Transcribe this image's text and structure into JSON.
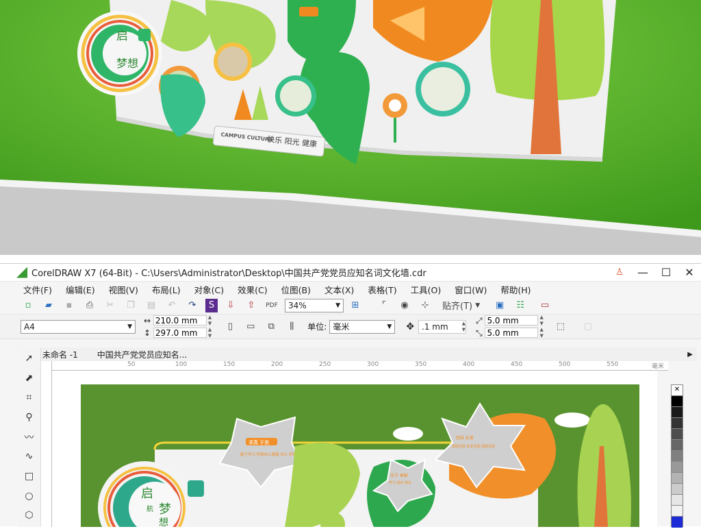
{
  "photo": {
    "campus_text": "CAMPUS CULTURE",
    "slogan": "快乐 阳光 健康",
    "badge_top": "启",
    "badge_bottom": "梦想",
    "colors": {
      "wall": "#58b62c",
      "floor": "#c9c9c9",
      "board": "#f0f0f0",
      "leaf_green": "#2fb050",
      "leaf_light": "#a8d85a",
      "orange": "#f08a20",
      "tree_green": "#a6d64a",
      "trunk": "#e0743a"
    }
  },
  "window": {
    "title": "CorelDRAW X7 (64-Bit) - C:\\Users\\Administrator\\Desktop\\中国共产党党员应知名词文化墙.cdr",
    "menu": [
      "文件(F)",
      "编辑(E)",
      "视图(V)",
      "布局(L)",
      "对象(C)",
      "效果(C)",
      "位图(B)",
      "文本(X)",
      "表格(T)",
      "工具(O)",
      "窗口(W)",
      "帮助(H)"
    ],
    "toolbar": {
      "zoom": "34%",
      "snap": "贴齐(T)"
    },
    "property": {
      "page_size": "A4",
      "width": "210.0 mm",
      "height": "297.0 mm",
      "unit_label": "单位:",
      "unit": "毫米",
      "nudge": ".1 mm",
      "dup_x": "5.0 mm",
      "dup_y": "5.0 mm"
    },
    "doc_tabs": [
      "未命名 -1",
      "中国共产党党员应知名..."
    ],
    "ruler_labels": [
      "50",
      "100",
      "150",
      "200",
      "250",
      "300",
      "350",
      "400",
      "450",
      "500",
      "550"
    ],
    "ruler_unit": "毫米",
    "design": {
      "star1_title": "求真 于思",
      "star1_text": "勤于学习 积极向上健康 向上 积极",
      "star2_title": "乐于 奉献",
      "star2_text": "学习 进步 快乐",
      "star3_title": "团结 友爱",
      "star3_text": "团结互助 友爱互助 团结互助",
      "badge_qi": "启",
      "badge_hang": "航",
      "badge_meng": "梦",
      "badge_xiang": "想",
      "colors": {
        "bg": "#59932f",
        "panel": "#f3f3f3",
        "orange": "#f1902a",
        "green": "#2ea84e",
        "light_green": "#a8d251"
      }
    },
    "palette": [
      "#ffffff",
      "#000000",
      "#1a1a1a",
      "#333333",
      "#4d4d4d",
      "#666666",
      "#808080",
      "#999999",
      "#b3b3b3",
      "#cccccc",
      "#e6e6e6",
      "#f2f2f2",
      "#ffffff"
    ]
  }
}
